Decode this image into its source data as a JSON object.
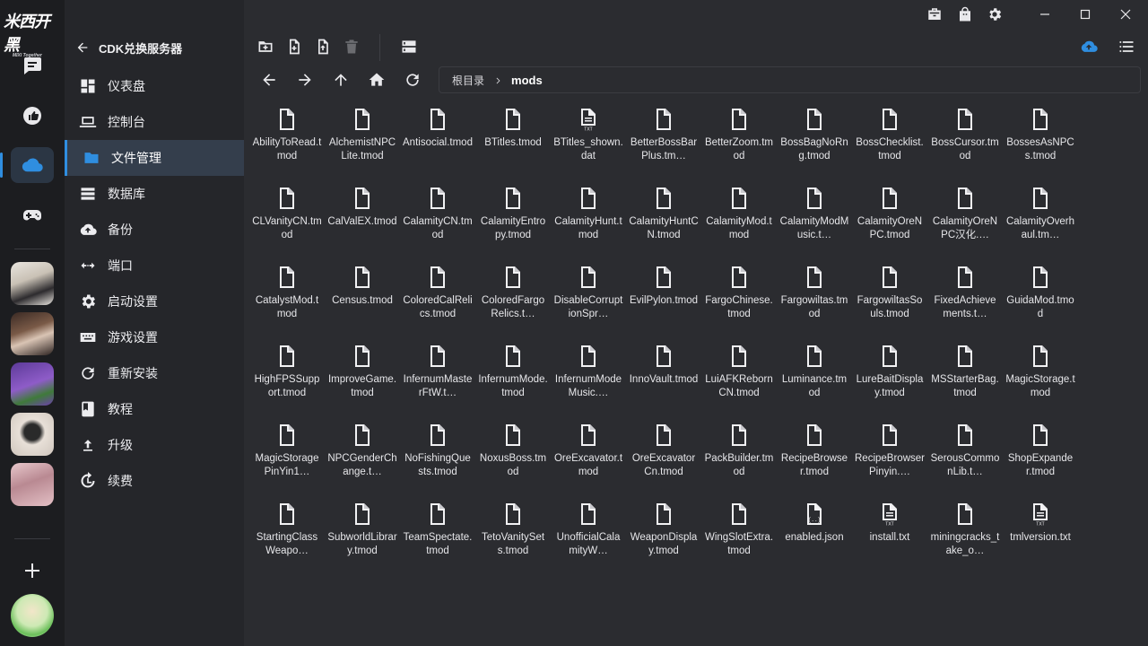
{
  "app": {
    "logo_text": "米西开黑",
    "logo_sub": "MIXI Together"
  },
  "nav": {
    "back_label": "CDK兑换服务器",
    "items": [
      {
        "label": "仪表盘",
        "icon": "dashboard-icon"
      },
      {
        "label": "控制台",
        "icon": "laptop-icon"
      },
      {
        "label": "文件管理",
        "icon": "folder-icon",
        "active": true
      },
      {
        "label": "数据库",
        "icon": "database-icon"
      },
      {
        "label": "备份",
        "icon": "cloud-upload-icon"
      },
      {
        "label": "端口",
        "icon": "port-arrows-icon"
      },
      {
        "label": "启动设置",
        "icon": "gear-icon"
      },
      {
        "label": "游戏设置",
        "icon": "keyboard-icon"
      },
      {
        "label": "重新安装",
        "icon": "reload-icon"
      },
      {
        "label": "教程",
        "icon": "book-icon"
      },
      {
        "label": "升级",
        "icon": "upgrade-arrow-icon"
      },
      {
        "label": "续费",
        "icon": "renew-icon"
      }
    ]
  },
  "path": {
    "root": "根目录",
    "current": "mods"
  },
  "colors": {
    "accent": "#2f8ee0",
    "background": "#2b2c30",
    "nav_bg": "#25262a",
    "rail_bg": "#1c1d20"
  },
  "files": [
    {
      "name": "AbilityToRead.tmod",
      "type": "file"
    },
    {
      "name": "AlchemistNPCLite.tmod",
      "type": "file"
    },
    {
      "name": "Antisocial.tmod",
      "type": "file"
    },
    {
      "name": "BTitles.tmod",
      "type": "file"
    },
    {
      "name": "BTitles_shown.dat",
      "type": "text"
    },
    {
      "name": "BetterBossBarPlus.tm…",
      "type": "file"
    },
    {
      "name": "BetterZoom.tmod",
      "type": "file"
    },
    {
      "name": "BossBagNoRng.tmod",
      "type": "file"
    },
    {
      "name": "BossChecklist.tmod",
      "type": "file"
    },
    {
      "name": "BossCursor.tmod",
      "type": "file"
    },
    {
      "name": "BossesAsNPCs.tmod",
      "type": "file"
    },
    {
      "name": "CLVanityCN.tmod",
      "type": "file"
    },
    {
      "name": "CalValEX.tmod",
      "type": "file"
    },
    {
      "name": "CalamityCN.tmod",
      "type": "file"
    },
    {
      "name": "CalamityEntropy.tmod",
      "type": "file"
    },
    {
      "name": "CalamityHunt.tmod",
      "type": "file"
    },
    {
      "name": "CalamityHuntCN.tmod",
      "type": "file"
    },
    {
      "name": "CalamityMod.tmod",
      "type": "file"
    },
    {
      "name": "CalamityModMusic.t…",
      "type": "file"
    },
    {
      "name": "CalamityOreNPC.tmod",
      "type": "file"
    },
    {
      "name": "CalamityOreNPC汉化.…",
      "type": "file"
    },
    {
      "name": "CalamityOverhaul.tm…",
      "type": "file"
    },
    {
      "name": "CatalystMod.tmod",
      "type": "file"
    },
    {
      "name": "Census.tmod",
      "type": "file"
    },
    {
      "name": "ColoredCalRelics.tmod",
      "type": "file"
    },
    {
      "name": "ColoredFargoRelics.t…",
      "type": "file"
    },
    {
      "name": "DisableCorruptionSpr…",
      "type": "file"
    },
    {
      "name": "EvilPylon.tmod",
      "type": "file"
    },
    {
      "name": "FargoChinese.tmod",
      "type": "file"
    },
    {
      "name": "Fargowiltas.tmod",
      "type": "file"
    },
    {
      "name": "FargowiltasSouls.tmod",
      "type": "file"
    },
    {
      "name": "FixedAchievements.t…",
      "type": "file"
    },
    {
      "name": "GuidaMod.tmod",
      "type": "file"
    },
    {
      "name": "HighFPSSupport.tmod",
      "type": "file"
    },
    {
      "name": "ImproveGame.tmod",
      "type": "file"
    },
    {
      "name": "InfernumMasterFtW.t…",
      "type": "file"
    },
    {
      "name": "InfernumMode.tmod",
      "type": "file"
    },
    {
      "name": "InfernumModeMusic.…",
      "type": "file"
    },
    {
      "name": "InnoVault.tmod",
      "type": "file"
    },
    {
      "name": "LuiAFKRebornCN.tmod",
      "type": "file"
    },
    {
      "name": "Luminance.tmod",
      "type": "file"
    },
    {
      "name": "LureBaitDisplay.tmod",
      "type": "file"
    },
    {
      "name": "MSStarterBag.tmod",
      "type": "file"
    },
    {
      "name": "MagicStorage.tmod",
      "type": "file"
    },
    {
      "name": "MagicStoragePinYin1…",
      "type": "file"
    },
    {
      "name": "NPCGenderChange.t…",
      "type": "file"
    },
    {
      "name": "NoFishingQuests.tmod",
      "type": "file"
    },
    {
      "name": "NoxusBoss.tmod",
      "type": "file"
    },
    {
      "name": "OreExcavator.tmod",
      "type": "file"
    },
    {
      "name": "OreExcavatorCn.tmod",
      "type": "file"
    },
    {
      "name": "PackBuilder.tmod",
      "type": "file"
    },
    {
      "name": "RecipeBrowser.tmod",
      "type": "file"
    },
    {
      "name": "RecipeBrowserPinyin.…",
      "type": "file"
    },
    {
      "name": "SerousCommonLib.t…",
      "type": "file"
    },
    {
      "name": "ShopExpander.tmod",
      "type": "file"
    },
    {
      "name": "StartingClassWeapo…",
      "type": "file"
    },
    {
      "name": "SubworldLibrary.tmod",
      "type": "file"
    },
    {
      "name": "TeamSpectate.tmod",
      "type": "file"
    },
    {
      "name": "TetoVanitySets.tmod",
      "type": "file"
    },
    {
      "name": "UnofficialCalamityW…",
      "type": "file"
    },
    {
      "name": "WeaponDisplay.tmod",
      "type": "file"
    },
    {
      "name": "WingSlotExtra.tmod",
      "type": "file"
    },
    {
      "name": "enabled.json",
      "type": "json"
    },
    {
      "name": "install.txt",
      "type": "text"
    },
    {
      "name": "miningcracks_take_o…",
      "type": "file"
    },
    {
      "name": "tmlversion.txt",
      "type": "text"
    }
  ]
}
